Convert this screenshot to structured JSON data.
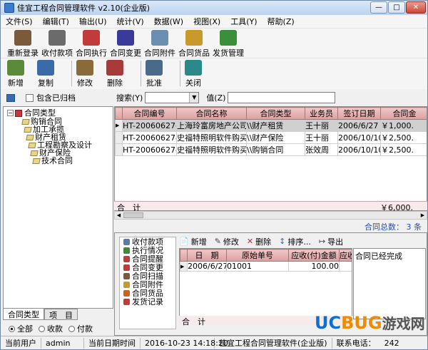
{
  "window": {
    "title": "佳宜工程合同管理软件 v2.10(企业版)"
  },
  "menu": [
    "文件(S)",
    "编辑(T)",
    "输出(U)",
    "统计(V)",
    "数据(W)",
    "视图(X)",
    "工具(Y)",
    "帮助(Z)"
  ],
  "toolbar1": [
    {
      "label": "重新登录",
      "icon": "login-icon",
      "color": "#7a5a3a"
    },
    {
      "label": "收付款项",
      "icon": "money-bag-icon",
      "color": "#6b6b6b"
    },
    {
      "label": "合同执行",
      "icon": "running-person-icon",
      "color": "#c23a3a"
    },
    {
      "label": "合同变更",
      "icon": "tools-icon",
      "color": "#3a3a9a"
    },
    {
      "label": "合同附件",
      "icon": "clock-icon",
      "color": "#6b8fb0"
    },
    {
      "label": "合同货品",
      "icon": "goods-icon",
      "color": "#c99a2a"
    },
    {
      "label": "发货管理",
      "icon": "shipping-icon",
      "color": "#3b8f3b"
    }
  ],
  "toolbar2": [
    {
      "label": "新增",
      "icon": "new-icon",
      "color": "#5a8a3a"
    },
    {
      "label": "复制",
      "icon": "copy-icon",
      "color": "#3a6aa8"
    },
    {
      "label": "修改",
      "icon": "edit-icon",
      "color": "#8a6a3a"
    },
    {
      "label": "删除",
      "icon": "delete-icon",
      "color": "#a83a3a"
    },
    {
      "label": "批准",
      "icon": "approve-icon",
      "color": "#4a6a8a"
    },
    {
      "label": "关闭",
      "icon": "exit-icon",
      "color": "#2a8a8a"
    }
  ],
  "search": {
    "archived_label": "包含已归档",
    "search_label": "搜索(Y)",
    "value_label": "值(Z)",
    "field_value": "",
    "value": ""
  },
  "tree": {
    "root": "合同类型",
    "items": [
      "购销合同",
      "加工承揽",
      "财产租赁",
      "工程勘察及设计",
      "财产保险",
      "技术合同"
    ]
  },
  "left_tabs": [
    "合同类型",
    "项　目"
  ],
  "radios": [
    "全部",
    "收款",
    "付款"
  ],
  "grid": {
    "columns": [
      "合同编号",
      "合同名称",
      "合同类型",
      "业务员",
      "签订日期",
      "合同金"
    ],
    "rows": [
      {
        "cells": [
          "HT-20060627-00",
          "上海玲富房地产公司",
          "\\\\财产租赁",
          "王十丽",
          "2006/6/27",
          "￥1,000."
        ],
        "selected": true
      },
      {
        "cells": [
          "HT-20060627-00",
          "史福特照明软件购买",
          "\\\\财产保险",
          "王十丽",
          "2006/10/10",
          "￥2,500."
        ],
        "selected": false
      },
      {
        "cells": [
          "HT-20060627-00",
          "史福特照明软件购买",
          "\\\\购销合同",
          "张效周",
          "2006/10/10",
          "￥2,500."
        ],
        "selected": false
      }
    ],
    "total_label": "合　计",
    "total_amount": "￥6,000."
  },
  "summary": "合同总数： 3 条",
  "subnav": [
    "收付款项",
    "执行情况",
    "合同提醒",
    "合同变更",
    "合同扫描",
    "合同附件",
    "合同货品",
    "发货记录"
  ],
  "subtoolbar": [
    "新增",
    "修改",
    "删除",
    "排序...",
    "导出"
  ],
  "subgrid": {
    "columns": [
      "日　期",
      "原始单号",
      "应收(付)金额",
      "应收"
    ],
    "rows": [
      [
        "2006/6/27",
        "01001",
        "100.00",
        ""
      ]
    ],
    "total_label": "合　计"
  },
  "memo": "合同已经完成",
  "status": {
    "user_label": "当前用户",
    "user": "admin",
    "date_label": "当前日期时间",
    "datetime": "2016-10-23 14:18:20",
    "company": "佳宜工程合同管理软件(企业版)",
    "contact": "联系电话：",
    "code": "242"
  },
  "watermark": {
    "uc": "UC",
    "bug": "BUG",
    "cn": "游戏网"
  }
}
